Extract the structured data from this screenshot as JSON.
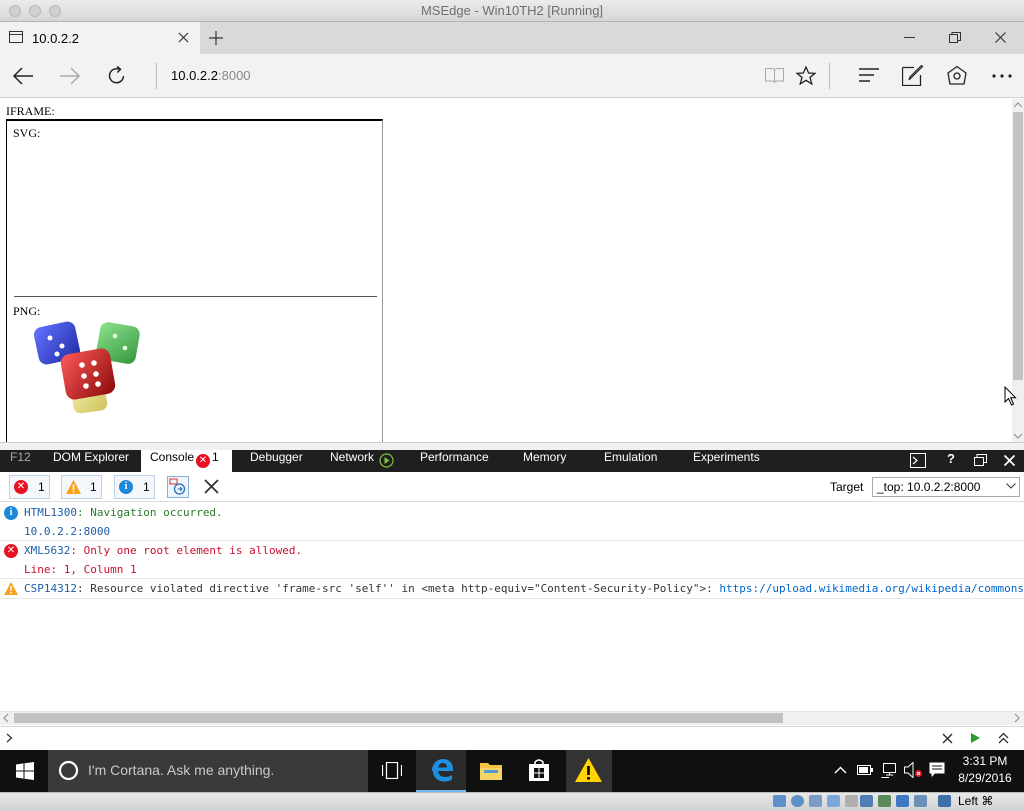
{
  "mac_window": {
    "title": "MSEdge - Win10TH2 [Running]"
  },
  "browser": {
    "tab_title": "10.0.2.2",
    "address_host": "10.0.2.2",
    "address_port": ":8000"
  },
  "page": {
    "iframe_label": "IFRAME:",
    "svg_label": "SVG:",
    "png_label": "PNG:"
  },
  "devtools": {
    "tabs": [
      {
        "label": "F12"
      },
      {
        "label": "DOM Explorer"
      },
      {
        "label": "Console",
        "badge": "1"
      },
      {
        "label": "Debugger"
      },
      {
        "label": "Network"
      },
      {
        "label": "Performance"
      },
      {
        "label": "Memory"
      },
      {
        "label": "Emulation"
      },
      {
        "label": "Experiments"
      }
    ],
    "filters": {
      "errors": "1",
      "warnings": "1",
      "info": "1"
    },
    "target_label": "Target",
    "target_value": "_top: 10.0.2.2:8000",
    "messages": [
      {
        "level": "info",
        "code": "HTML1300",
        "text": ": Navigation occurred.",
        "detail": "10.0.2.2:8000"
      },
      {
        "level": "error",
        "code": "XML5632",
        "text": ": Only one root element is allowed.",
        "detail": "Line: 1, Column 1"
      },
      {
        "level": "warning",
        "code": "CSP14312",
        "text": ": Resource violated directive 'frame-src 'self'' in <meta http-equiv=\"Content-Security-Policy\">: ",
        "link": "https://upload.wikimedia.org/wikipedia/commons"
      }
    ]
  },
  "taskbar": {
    "cortana_placeholder": "I'm Cortana. Ask me anything.",
    "time": "3:31 PM",
    "date": "8/29/2016"
  },
  "vbox": {
    "host_key": "Left ⌘"
  },
  "colors": {
    "error": "#e81123",
    "warning": "#f7a21b",
    "info": "#1e88d8",
    "code_green": "#2b7a2b",
    "error_text": "#c8102e",
    "link_blue": "#0066cc"
  }
}
